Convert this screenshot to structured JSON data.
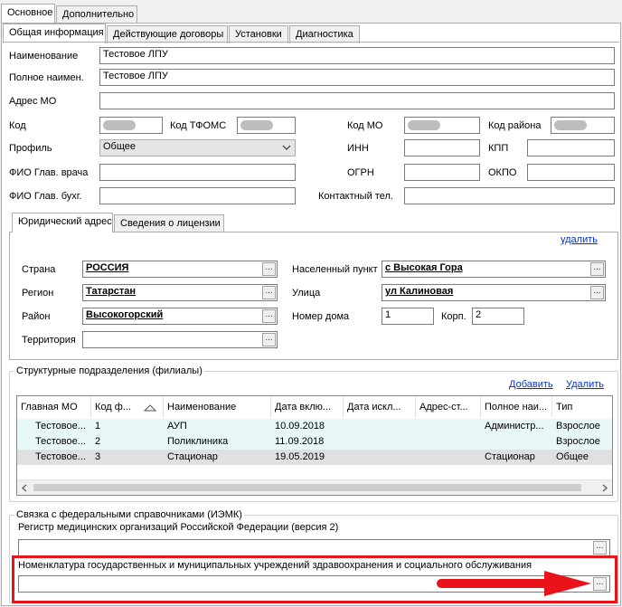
{
  "top_tabs": [
    "Основное",
    "Дополнительно"
  ],
  "sub_tabs": [
    "Общая информация",
    "Действующие договоры",
    "Установки",
    "Диагностика"
  ],
  "fields": {
    "name_label": "Наименование",
    "name_value": "Тестовое ЛПУ",
    "fullname_label": "Полное наимен.",
    "fullname_value": "Тестовое ЛПУ",
    "address_label": "Адрес МО",
    "address_value": "",
    "code_label": "Код",
    "tfoms_label": "Код ТФОМС",
    "mo_code_label": "Код МО",
    "district_code_label": "Код района",
    "profile_label": "Профиль",
    "profile_value": "Общее",
    "inn_label": "ИНН",
    "kpp_label": "КПП",
    "head_doctor_label": "ФИО Глав. врача",
    "ogrn_label": "ОГРН",
    "okpo_label": "ОКПО",
    "head_accountant_label": "ФИО Глав. бухг.",
    "phone_label": "Контактный тел."
  },
  "address_tabs": [
    "Юридический адрес",
    "Сведения о лицензии"
  ],
  "address": {
    "delete_link": "удалить",
    "country_label": "Страна",
    "country_value": "РОССИЯ",
    "region_label": "Регион",
    "region_value": "Татарстан",
    "area_label": "Район",
    "area_value": "Высокогорский",
    "territory_label": "Территория",
    "territory_value": "",
    "locality_label": "Населенный пункт",
    "locality_value": "с Высокая Гора",
    "street_label": "Улица",
    "street_value": "ул Калиновая",
    "house_label": "Номер дома",
    "house_value": "1",
    "building_label": "Корп.",
    "building_value": "2"
  },
  "branches": {
    "title": "Структурные подразделения (филиалы)",
    "add_link": "Добавить",
    "delete_link": "Удалить",
    "columns": [
      "Главная МО",
      "Код ф...",
      "Наименование",
      "Дата вклю...",
      "Дата искл...",
      "Адрес-ст...",
      "Полное наи...",
      "Тип"
    ],
    "rows": [
      [
        "Тестовое...",
        "1",
        "АУП",
        "10.09.2018",
        "",
        "",
        "Администр...",
        "Взрослое"
      ],
      [
        "Тестовое...",
        "2",
        "Поликлиника",
        "11.09.2018",
        "",
        "",
        "",
        "Взрослое"
      ],
      [
        "Тестовое...",
        "3",
        "Стационар",
        "19.05.2019",
        "",
        "",
        "Стационар",
        "Общее"
      ]
    ]
  },
  "federal": {
    "title": "Связка с федеральными справочниками (ИЭМК)",
    "register_label": "Регистр медицинских организаций Российской Федерации (версия 2)",
    "register_value": "",
    "nomenclature_label": "Номенклатура государственных и муниципальных учреждений здравоохранения и социального обслуживания",
    "nomenclature_value": ""
  },
  "icons": {
    "ellipsis": "...",
    "sort_up": "sort-ascending-icon",
    "chevron_down": "chevron-down-icon"
  },
  "colors": {
    "highlight_red": "#e8141a",
    "grid_row_alt": "#e8f8f8",
    "grid_row_selected": "#e0e0e0"
  }
}
